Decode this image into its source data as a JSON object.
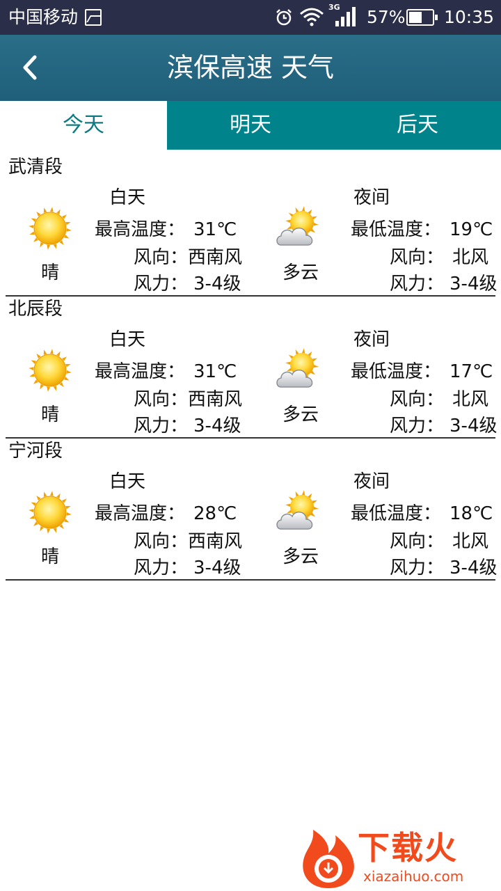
{
  "status_bar": {
    "carrier": "中国移动",
    "net_type": "3G",
    "battery_percent": "57%",
    "battery_level": 0.57,
    "time": "10:35"
  },
  "header": {
    "title": "滨保高速  天气"
  },
  "tabs": [
    {
      "label": "今天",
      "active": true
    },
    {
      "label": "明天",
      "active": false
    },
    {
      "label": "后天",
      "active": false
    }
  ],
  "labels": {
    "day": "白天",
    "night": "夜间",
    "max_temp": "最高温度：",
    "min_temp": "最低温度：",
    "wind_dir": "风向：",
    "wind_force": "风力："
  },
  "sections": [
    {
      "name": "武清段",
      "day": {
        "icon": "sunny-icon",
        "condition": "晴",
        "temp": "31℃",
        "wind_dir": "西南风",
        "wind_force": "3-4级"
      },
      "night": {
        "icon": "partly-cloudy-icon",
        "condition": "多云",
        "temp": "19℃",
        "wind_dir": "北风",
        "wind_force": "3-4级"
      }
    },
    {
      "name": "北辰段",
      "day": {
        "icon": "sunny-icon",
        "condition": "晴",
        "temp": "31℃",
        "wind_dir": "西南风",
        "wind_force": "3-4级"
      },
      "night": {
        "icon": "partly-cloudy-icon",
        "condition": "多云",
        "temp": "17℃",
        "wind_dir": "北风",
        "wind_force": "3-4级"
      }
    },
    {
      "name": "宁河段",
      "day": {
        "icon": "sunny-icon",
        "condition": "晴",
        "temp": "28℃",
        "wind_dir": "西南风",
        "wind_force": "3-4级"
      },
      "night": {
        "icon": "partly-cloudy-icon",
        "condition": "多云",
        "temp": "18℃",
        "wind_dir": "北风",
        "wind_force": "3-4级"
      }
    }
  ],
  "watermark": {
    "brand": "下载火",
    "url": "xiazaihuo.com",
    "color": "#f04a1d"
  },
  "colors": {
    "status_bar": "#2b2e49",
    "header": "#1f5f7a",
    "tab_bar": "#00838a",
    "tab_active_text": "#0e7a82"
  }
}
